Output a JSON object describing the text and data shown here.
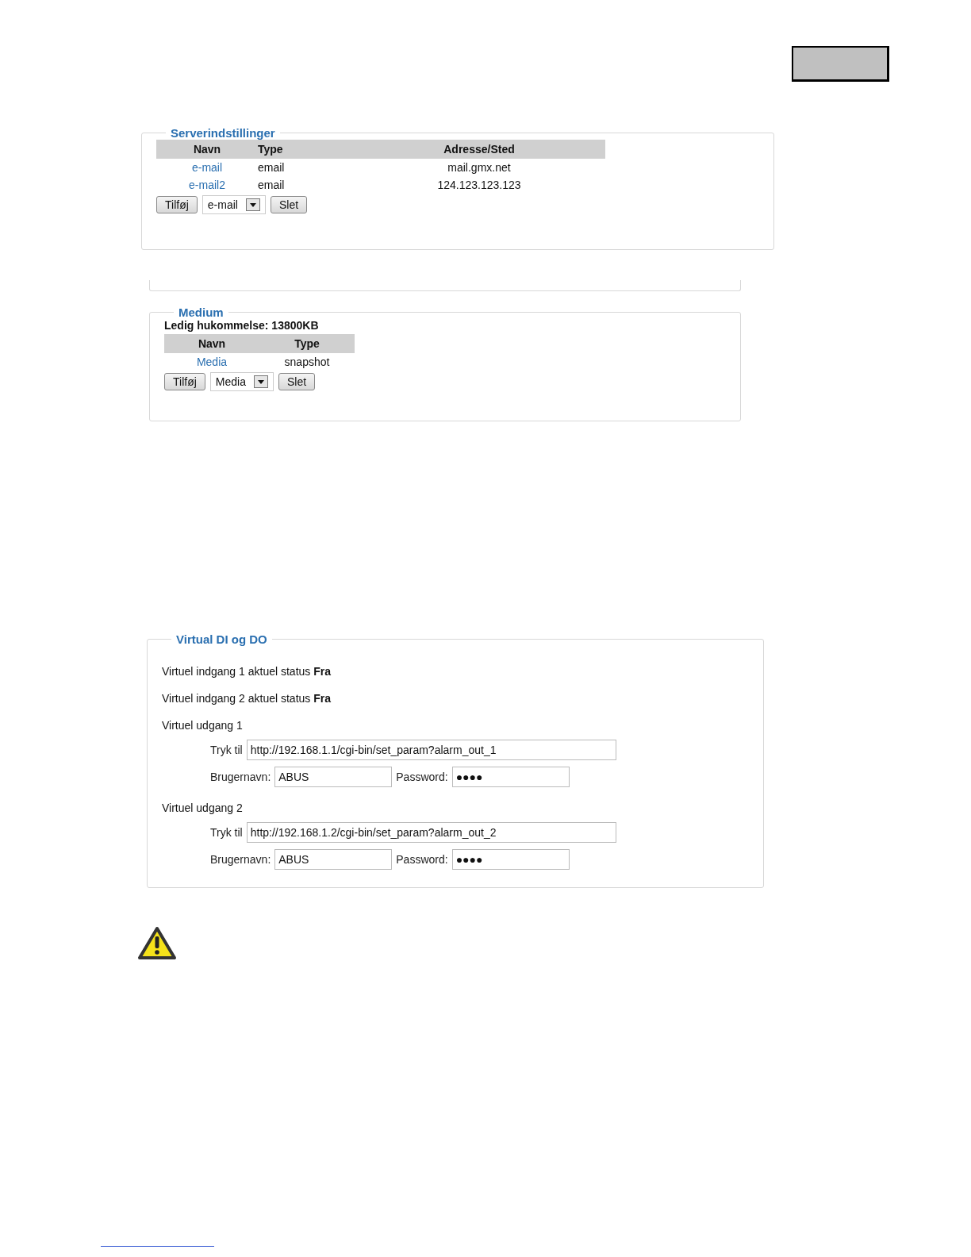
{
  "server_settings": {
    "title": "Serverindstillinger",
    "columns": [
      "Navn",
      "Type",
      "Adresse/Sted"
    ],
    "rows": [
      {
        "name": "e-mail",
        "type": "email",
        "address": "mail.gmx.net"
      },
      {
        "name": "e-mail2",
        "type": "email",
        "address": "124.123.123.123"
      }
    ],
    "add_button": "Tilføj",
    "select_value": "e-mail",
    "delete_button": "Slet"
  },
  "medium": {
    "title": "Medium",
    "free_memory": "Ledig hukommelse: 13800KB",
    "columns": [
      "Navn",
      "Type"
    ],
    "rows": [
      {
        "name": "Media",
        "type": "snapshot"
      }
    ],
    "add_button": "Tilføj",
    "select_value": "Media",
    "delete_button": "Slet"
  },
  "virtual_io": {
    "title": "Virtual DI og DO",
    "inputs": [
      "Virtuel indgang 1 aktuel status **Fra**",
      "Virtuel indgang 2 aktuel status **Fra**"
    ],
    "outputs": [
      {
        "label": "Virtuel udgang 1",
        "push_label": "Tryk til",
        "url": "http://192.168.1.1/cgi-bin/set_param?alarm_out_1",
        "user_label": "Brugernavn:",
        "user": "ABUS",
        "password_label": "Password:",
        "password": "●●●●"
      },
      {
        "label": "Virtuel udgang 2",
        "push_label": "Tryk til",
        "url": "http://192.168.1.2/cgi-bin/set_param?alarm_out_2",
        "user_label": "Brugernavn:",
        "user": "ABUS",
        "password_label": "Password:",
        "password": "●●●●"
      }
    ]
  }
}
